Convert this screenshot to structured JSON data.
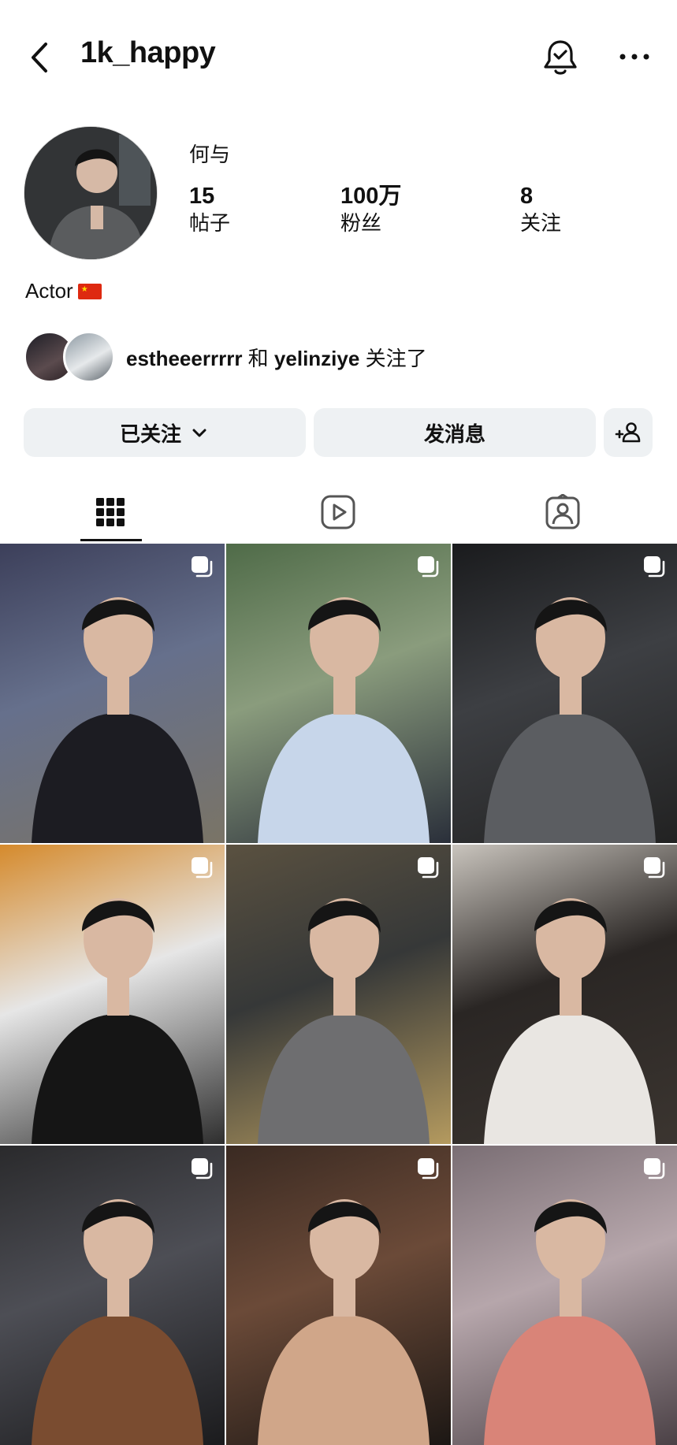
{
  "header": {
    "username": "1k_happy",
    "back_icon": "chevron-left-icon",
    "bell_icon": "bell-check-icon",
    "more_icon": "more-dots-icon"
  },
  "profile": {
    "display_name": "何与",
    "stats": [
      {
        "value": "15",
        "label": "帖子"
      },
      {
        "value": "100万",
        "label": "粉丝"
      },
      {
        "value": "8",
        "label": "关注"
      }
    ],
    "bio": "Actor",
    "bio_emoji": "china-flag",
    "mutual": {
      "user1": "estheeerrrrr",
      "conj": "和",
      "user2": "yelinziye",
      "suffix": "关注了"
    }
  },
  "actions": {
    "following_label": "已关注",
    "message_label": "发消息",
    "add_icon": "add-person-icon"
  },
  "tabs": [
    {
      "name": "posts",
      "icon": "grid-icon",
      "active": true
    },
    {
      "name": "reels",
      "icon": "reels-play-icon",
      "active": false
    },
    {
      "name": "tagged",
      "icon": "tagged-person-icon",
      "active": false
    }
  ],
  "grid": [
    {
      "type": "carousel",
      "colors": [
        "#3c3f5a",
        "#66708c",
        "#1c1c22",
        "#7a7466"
      ]
    },
    {
      "type": "carousel",
      "colors": [
        "#4f6b48",
        "#8a9c7d",
        "#c7d6ea",
        "#2a2f3a"
      ]
    },
    {
      "type": "carousel",
      "colors": [
        "#1a1b1d",
        "#3d3f43",
        "#5b5d61",
        "#222"
      ]
    },
    {
      "type": "carousel",
      "colors": [
        "#d58a2c",
        "#e6e6e6",
        "#151515",
        "#2e2e2e"
      ]
    },
    {
      "type": "carousel",
      "colors": [
        "#5a5140",
        "#363838",
        "#6e6e70",
        "#b49a5f"
      ]
    },
    {
      "type": "carousel",
      "colors": [
        "#c9c4bd",
        "#2a2624",
        "#e9e6e2",
        "#3b3530"
      ]
    },
    {
      "type": "carousel",
      "colors": [
        "#2a2a2c",
        "#4d4e55",
        "#7a4c30",
        "#1b1b1d"
      ]
    },
    {
      "type": "carousel",
      "colors": [
        "#3a2a22",
        "#6b4a38",
        "#d0a689",
        "#1c1714"
      ]
    },
    {
      "type": "carousel",
      "colors": [
        "#7a6e74",
        "#b6a6ab",
        "#d98478",
        "#4b4146"
      ]
    }
  ]
}
